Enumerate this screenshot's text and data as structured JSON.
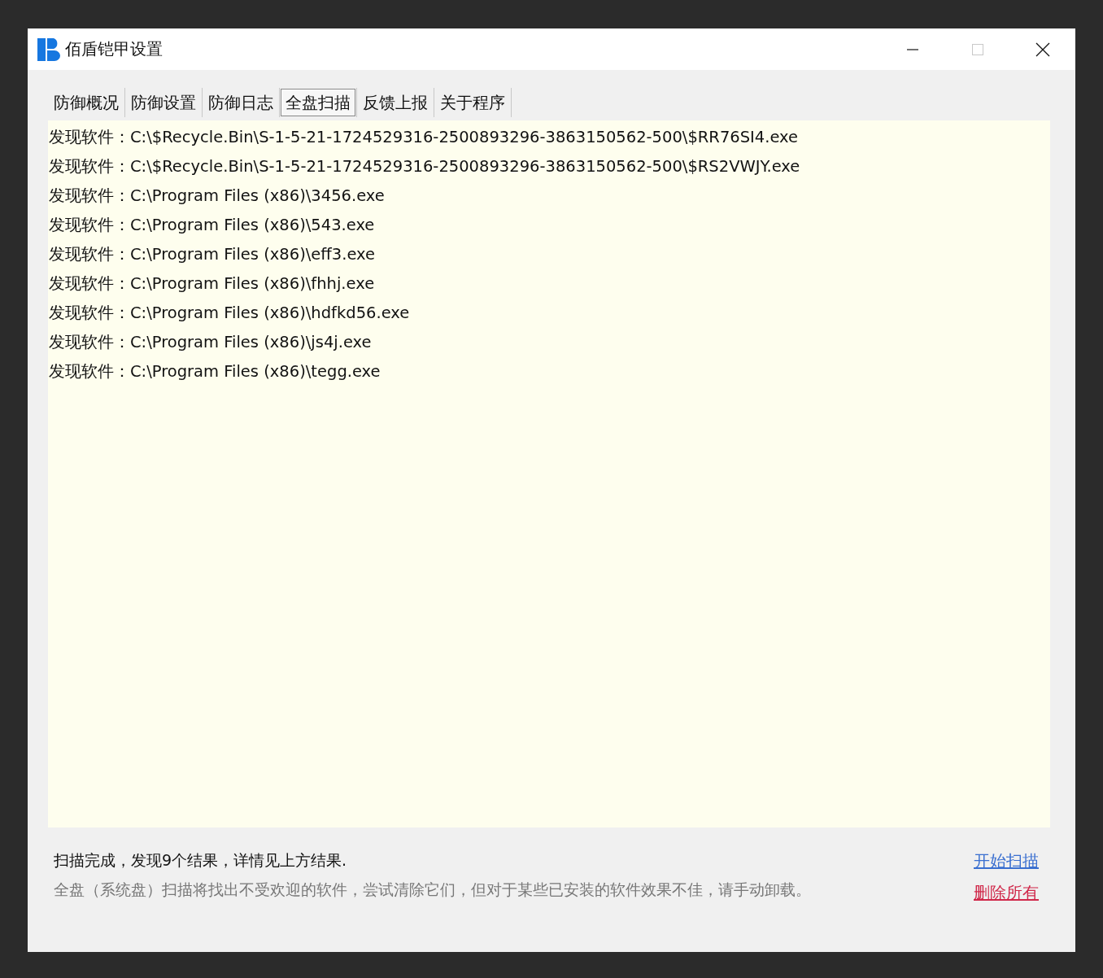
{
  "window": {
    "title": "佰盾铠甲设置",
    "maximize_disabled": true
  },
  "tabs": [
    {
      "label": "防御概况",
      "selected": false
    },
    {
      "label": "防御设置",
      "selected": false
    },
    {
      "label": "防御日志",
      "selected": false
    },
    {
      "label": "全盘扫描",
      "selected": true
    },
    {
      "label": "反馈上报",
      "selected": false
    },
    {
      "label": "关于程序",
      "selected": false
    }
  ],
  "results": [
    "发现软件：C:\\$Recycle.Bin\\S-1-5-21-1724529316-2500893296-3863150562-500\\$RR76SI4.exe",
    "发现软件：C:\\$Recycle.Bin\\S-1-5-21-1724529316-2500893296-3863150562-500\\$RS2VWJY.exe",
    "发现软件：C:\\Program Files (x86)\\3456.exe",
    "发现软件：C:\\Program Files (x86)\\543.exe",
    "发现软件：C:\\Program Files (x86)\\eff3.exe",
    "发现软件：C:\\Program Files (x86)\\fhhj.exe",
    "发现软件：C:\\Program Files (x86)\\hdfkd56.exe",
    "发现软件：C:\\Program Files (x86)\\js4j.exe",
    "发现软件：C:\\Program Files (x86)\\tegg.exe"
  ],
  "status": "扫描完成，发现9个结果，详情见上方结果.",
  "hint": "全盘（系统盘）扫描将找出不受欢迎的软件，尝试清除它们，但对于某些已安装的软件效果不佳，请手动卸载。",
  "links": [
    {
      "label": "开始扫描",
      "kind": "primary"
    },
    {
      "label": "删除所有",
      "kind": "danger"
    }
  ]
}
